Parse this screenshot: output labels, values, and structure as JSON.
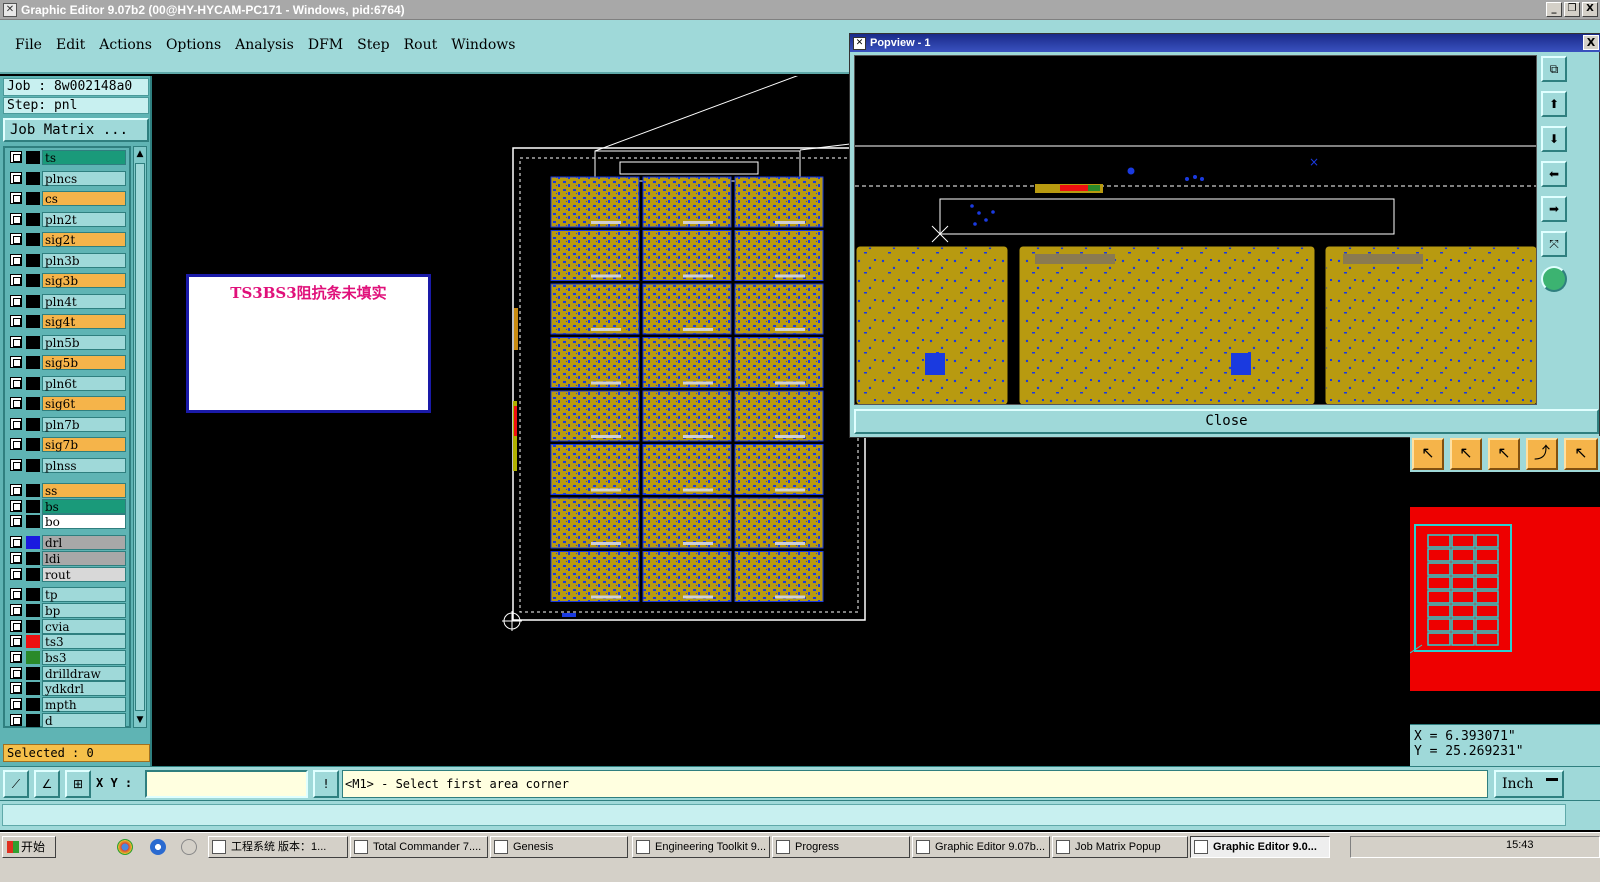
{
  "window": {
    "title": "Graphic Editor 9.07b2 (00@HY-HYCAM-PC171 - Windows, pid:6764)",
    "minimize": "_",
    "restore": "❐",
    "close": "X"
  },
  "menu": [
    "File",
    "Edit",
    "Actions",
    "Options",
    "Analysis",
    "DFM",
    "Step",
    "Rout",
    "Windows"
  ],
  "left_panel": {
    "job": "Job : 8w002148a0",
    "step": "Step: pnl",
    "job_matrix_button": "Job Matrix ...",
    "layers": [
      {
        "name": "ts",
        "bg": "#1a9a7a",
        "swatch": "#000000"
      },
      {
        "name": "plncs",
        "bg": "#9fd9d9",
        "swatch": "#000000"
      },
      {
        "name": "cs",
        "bg": "#f5b44a",
        "swatch": "#000000"
      },
      {
        "name": "pln2t",
        "bg": "#9fd9d9",
        "swatch": "#000000"
      },
      {
        "name": "sig2t",
        "bg": "#f5b44a",
        "swatch": "#000000"
      },
      {
        "name": "pln3b",
        "bg": "#9fd9d9",
        "swatch": "#000000"
      },
      {
        "name": "sig3b",
        "bg": "#f5b44a",
        "swatch": "#000000"
      },
      {
        "name": "pln4t",
        "bg": "#9fd9d9",
        "swatch": "#000000"
      },
      {
        "name": "sig4t",
        "bg": "#f5b44a",
        "swatch": "#000000"
      },
      {
        "name": "pln5b",
        "bg": "#9fd9d9",
        "swatch": "#000000"
      },
      {
        "name": "sig5b",
        "bg": "#f5b44a",
        "swatch": "#000000"
      },
      {
        "name": "pln6t",
        "bg": "#9fd9d9",
        "swatch": "#000000"
      },
      {
        "name": "sig6t",
        "bg": "#f5b44a",
        "swatch": "#000000"
      },
      {
        "name": "pln7b",
        "bg": "#9fd9d9",
        "swatch": "#000000"
      },
      {
        "name": "sig7b",
        "bg": "#f5b44a",
        "swatch": "#000000"
      },
      {
        "name": "plnss",
        "bg": "#9fd9d9",
        "swatch": "#000000"
      },
      {
        "name": "ss",
        "bg": "#f5b44a",
        "swatch": "#000000"
      },
      {
        "name": "bs",
        "bg": "#1a9a7a",
        "swatch": "#000000"
      },
      {
        "name": "bo",
        "bg": "#ffffff",
        "swatch": "#000000"
      },
      {
        "name": "drl",
        "bg": "#a8a8a8",
        "swatch": "#1a1ae0"
      },
      {
        "name": "ldi",
        "bg": "#a8a8a8",
        "swatch": "#000000"
      },
      {
        "name": "rout",
        "bg": "#d8d8d8",
        "swatch": "#000000"
      },
      {
        "name": "tp",
        "bg": "#9fd9d9",
        "swatch": "#000000"
      },
      {
        "name": "bp",
        "bg": "#9fd9d9",
        "swatch": "#000000"
      },
      {
        "name": "cvia",
        "bg": "#9fd9d9",
        "swatch": "#000000"
      },
      {
        "name": "ts3",
        "bg": "#9fd9d9",
        "swatch": "#ee1010"
      },
      {
        "name": "bs3",
        "bg": "#9fd9d9",
        "swatch": "#2a8a2a"
      },
      {
        "name": "drilldraw",
        "bg": "#9fd9d9",
        "swatch": "#000000"
      },
      {
        "name": "ydkdrl",
        "bg": "#9fd9d9",
        "swatch": "#000000"
      },
      {
        "name": "mpth",
        "bg": "#9fd9d9",
        "swatch": "#000000"
      },
      {
        "name": "d",
        "bg": "#9fd9d9",
        "swatch": "#000000"
      }
    ],
    "selected": "Selected : 0"
  },
  "note_box": {
    "text": "TS3BS3阻抗条未填实"
  },
  "popview": {
    "title": "Popview - 1",
    "close_x": "X",
    "close_button": "Close"
  },
  "coords": {
    "x": "X = 6.393071\"",
    "y": "Y = 25.269231\""
  },
  "command_bar": {
    "xy_label": "X Y :",
    "xy_value": "",
    "prompt": "<M1> - Select first area corner",
    "unit": "Inch"
  },
  "taskbar": {
    "start": "开始",
    "tasks": [
      "工程系统  版本：1...",
      "Total Commander 7....",
      "Genesis",
      "Engineering Toolkit 9...",
      "Progress",
      "Graphic Editor 9.07b...",
      "Job Matrix Popup",
      "Graphic Editor 9.0..."
    ],
    "clock": "15:43"
  },
  "colors": {
    "panel": "#9fd9d9",
    "board_copper": "#b89a10",
    "board_blue": "#1a3ae0",
    "minimap_bg": "#ee0000"
  }
}
